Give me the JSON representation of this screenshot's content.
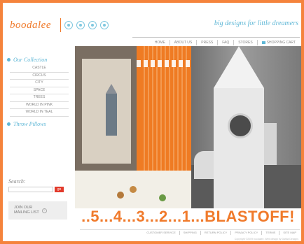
{
  "brand": {
    "logo": "boodalee",
    "tagline": "big designs for little dreamers",
    "accent": "#f07a2b",
    "secondary": "#5fb7d6",
    "icons": [
      "circle-icon",
      "circle-icon",
      "circle-icon",
      "circle-icon"
    ]
  },
  "topnav": [
    {
      "label": "HOME"
    },
    {
      "label": "ABOUT US"
    },
    {
      "label": "PRESS"
    },
    {
      "label": "FAQ"
    },
    {
      "label": "STORES"
    },
    {
      "label": "SHOPPING CART"
    }
  ],
  "sidebar": {
    "collection_title": "Our Collection",
    "collection_items": [
      "CASTLE",
      "CIRCUS",
      "CITY",
      "SPACE",
      "TREES",
      "WORLD IN PINK",
      "WORLD IN TEAL"
    ],
    "pillows_title": "Throw Pillows",
    "search_label": "Search:",
    "search_value": "",
    "go_label": "go",
    "mailing_label_1": "JOIN OUR",
    "mailing_label_2": "MAILING LIST"
  },
  "hero": {
    "caption": "..5...4...3...2...1...BLASTOFF!"
  },
  "footer": {
    "links": [
      "CUSTOMER SERVICE",
      "SHIPPING",
      "RETURN POLICY",
      "PRIVACY POLICY",
      "TERMS",
      "SITE MAP"
    ],
    "copyright": "Copyright ©2009 boodalee. Web design by Dahlia Designs"
  }
}
